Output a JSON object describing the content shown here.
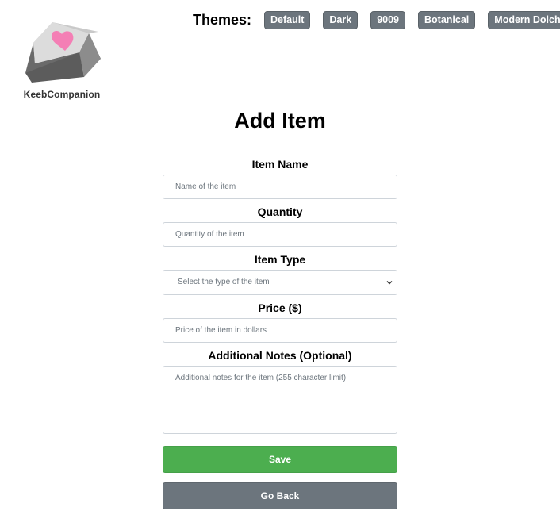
{
  "app": {
    "name": "KeebCompanion"
  },
  "themes": {
    "label": "Themes:",
    "options": [
      "Default",
      "Dark",
      "9009",
      "Botanical",
      "Modern Dolch"
    ]
  },
  "page": {
    "title": "Add Item"
  },
  "form": {
    "item_name": {
      "label": "Item Name",
      "placeholder": "Name of the item",
      "value": ""
    },
    "quantity": {
      "label": "Quantity",
      "placeholder": "Quantity of the item",
      "value": ""
    },
    "item_type": {
      "label": "Item Type",
      "selected": "Select the type of the item"
    },
    "price": {
      "label": "Price ($)",
      "placeholder": "Price of the item in dollars",
      "value": ""
    },
    "notes": {
      "label": "Additional Notes (Optional)",
      "placeholder": "Additional notes for the item (255 character limit)",
      "value": ""
    },
    "save_label": "Save",
    "back_label": "Go Back"
  },
  "colors": {
    "theme_button": "#6c757d",
    "save_button": "#4cae4f",
    "back_button": "#6c757d",
    "logo_heart": "#f47fb5"
  },
  "icons": {
    "logo": "keycap-heart-icon",
    "select": "chevron-down-icon"
  }
}
